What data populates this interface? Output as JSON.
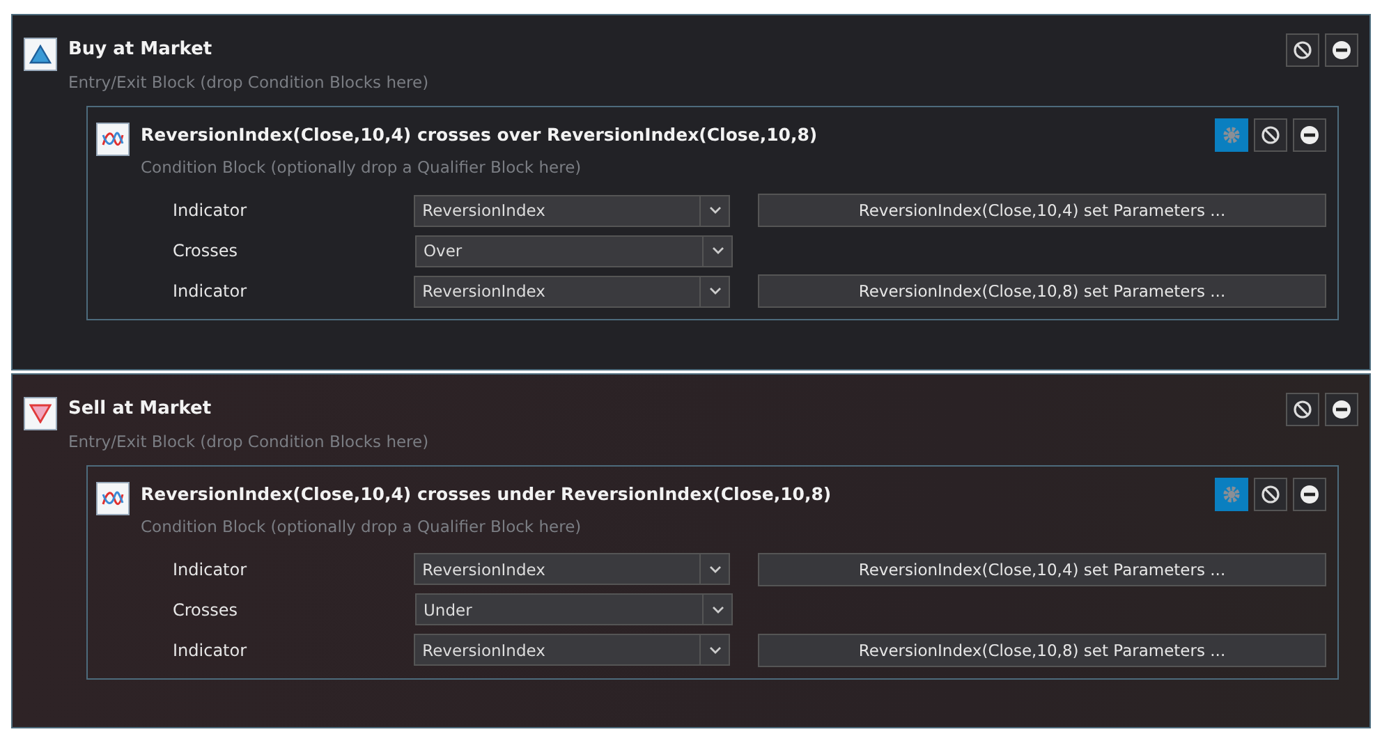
{
  "blocks": [
    {
      "kind": "buy",
      "title": "Buy at Market",
      "subtitle": "Entry/Exit Block (drop Condition Blocks here)",
      "condition": {
        "title": "ReversionIndex(Close,10,4) crosses over ReversionIndex(Close,10,8)",
        "subtitle": "Condition Block (optionally drop a Qualifier Block here)",
        "rows": [
          {
            "label": "Indicator",
            "value": "ReversionIndex",
            "parameters": "ReversionIndex(Close,10,4) set Parameters ..."
          },
          {
            "label": "Crosses",
            "value": "Over"
          },
          {
            "label": "Indicator",
            "value": "ReversionIndex",
            "parameters": "ReversionIndex(Close,10,8) set Parameters ..."
          }
        ]
      }
    },
    {
      "kind": "sell",
      "title": "Sell at Market",
      "subtitle": "Entry/Exit Block (drop Condition Blocks here)",
      "condition": {
        "title": "ReversionIndex(Close,10,4) crosses under ReversionIndex(Close,10,8)",
        "subtitle": "Condition Block (optionally drop a Qualifier Block here)",
        "rows": [
          {
            "label": "Indicator",
            "value": "ReversionIndex",
            "parameters": "ReversionIndex(Close,10,4) set Parameters ..."
          },
          {
            "label": "Crosses",
            "value": "Under"
          },
          {
            "label": "Indicator",
            "value": "ReversionIndex",
            "parameters": "ReversionIndex(Close,10,8) set Parameters ..."
          }
        ]
      }
    }
  ]
}
